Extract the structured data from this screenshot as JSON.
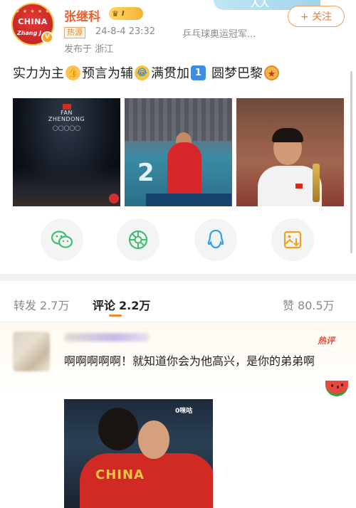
{
  "banner": {
    "text": "人人"
  },
  "author": {
    "avatar_text": "CHINA",
    "avatar_sub": "Zhang J",
    "name": "张继科",
    "level_label": "I",
    "hot_tag": "热源",
    "time": "24-8-4 23:32",
    "source": "乒乓球奥运冠军...",
    "location": "发布于 浙江",
    "follow_label": "+ 关注"
  },
  "post": {
    "segments": [
      "实力为主",
      "预言为辅",
      "满贯加",
      "圆梦巴黎"
    ],
    "emoji_one": "1",
    "photo1_caption": "FAN\nZHENDONG",
    "photo2_number": "2",
    "photo3_caption": ""
  },
  "share": {
    "icons": [
      "wechat-icon",
      "moments-icon",
      "qq-icon",
      "save-image-icon"
    ]
  },
  "tabs": {
    "repost_label": "转发",
    "repost_count": "2.7万",
    "comment_label": "评论",
    "comment_count": "2.2万",
    "like_label": "赞",
    "like_count": "80.5万"
  },
  "comment": {
    "hot_label": "热评",
    "text": "啊啊啊啊啊！就知道你会为他高兴，是你的弟弟啊",
    "image_logo": "CHINA",
    "image_corner": "0咪咕"
  },
  "colors": {
    "accent": "#ef7b2b",
    "username": "#e8612d",
    "hot_comment": "#ea4a3a"
  }
}
